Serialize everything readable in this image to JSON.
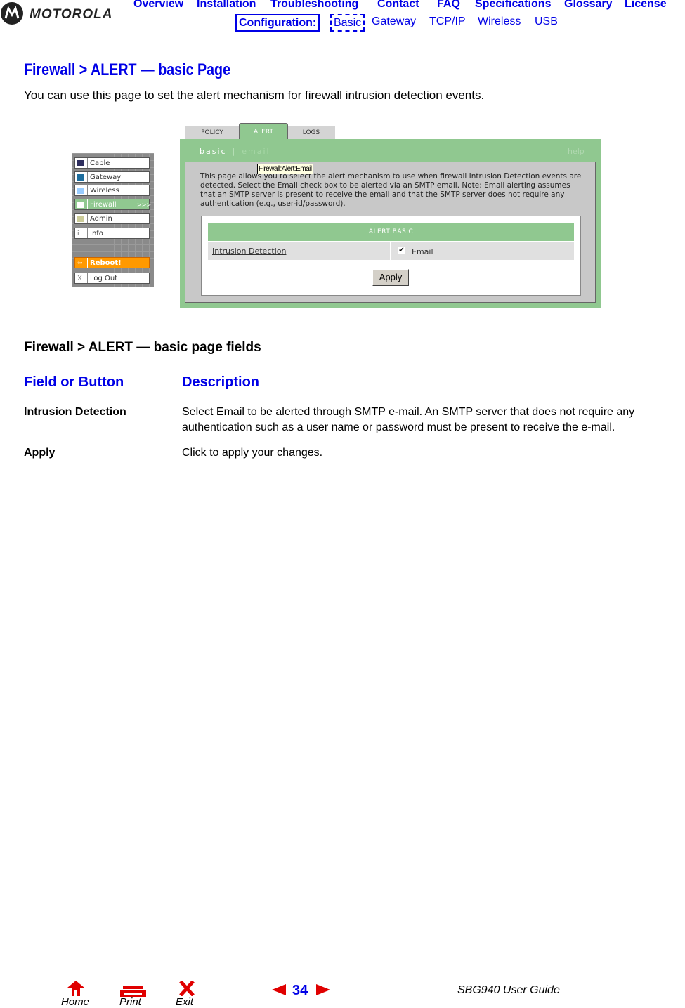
{
  "header": {
    "brand": "MOTOROLA",
    "top_nav": [
      "Overview",
      "Installation",
      "Troubleshooting",
      "Contact",
      "FAQ",
      "Specifications",
      "Glossary",
      "License"
    ],
    "config_label": "Configuration:",
    "sub_nav": [
      "Basic",
      "Gateway",
      "TCP/IP",
      "Wireless",
      "USB"
    ]
  },
  "page": {
    "title": "Firewall > ALERT — basic Page",
    "intro": "You can use this page to set the alert mechanism for firewall intrusion detection events."
  },
  "screenshot": {
    "sidebar": [
      {
        "label": "Cable",
        "color": "#2e2e5e"
      },
      {
        "label": "Gateway",
        "color": "#1e6e9e"
      },
      {
        "label": "Wireless",
        "color": "#99ccff"
      },
      {
        "label": "Firewall",
        "color": "#ffffff",
        "suffix": ">>>"
      },
      {
        "label": "Admin",
        "color": "#cccc99"
      },
      {
        "label": "Info",
        "icon": "i"
      },
      {
        "label": "Reboot!",
        "icon": "⇦"
      },
      {
        "label": "Log Out",
        "icon": "X"
      }
    ],
    "tabs": [
      "POLICY",
      "ALERT",
      "LOGS"
    ],
    "active_tab": "ALERT",
    "sub_links": {
      "basic": "basic",
      "separator": "|",
      "email": "email",
      "help": "help"
    },
    "tooltip": "Firewall:Alert:Email",
    "description": "This page allows you to select the alert mechanism to use when firewall Intrusion Detection events are detected. Select the Email check box to be alerted via an SMTP email. Note: Email alerting assumes that an SMTP server is present to receive the email and that the SMTP server does not require any authentication (e.g., user-id/password).",
    "form_header": "ALERT BASIC",
    "field_label": "Intrusion Detection",
    "checkbox_label": "Email",
    "checkbox_checked": true,
    "checkbox_glyph": "✔",
    "apply_label": "Apply"
  },
  "fields_section": {
    "title": "Firewall > ALERT — basic page fields",
    "col_field": "Field or Button",
    "col_desc": "Description",
    "rows": [
      {
        "name": "Intrusion Detection",
        "desc": "Select Email to be alerted through SMTP e-mail. An SMTP server that does not require any authentication such as a user name or password must be present to receive the e-mail."
      },
      {
        "name": "Apply",
        "desc": "Click to apply your changes."
      }
    ]
  },
  "footer": {
    "home": "Home",
    "print": "Print",
    "exit": "Exit",
    "page_number": "34",
    "guide_title": "SBG940 User Guide"
  }
}
